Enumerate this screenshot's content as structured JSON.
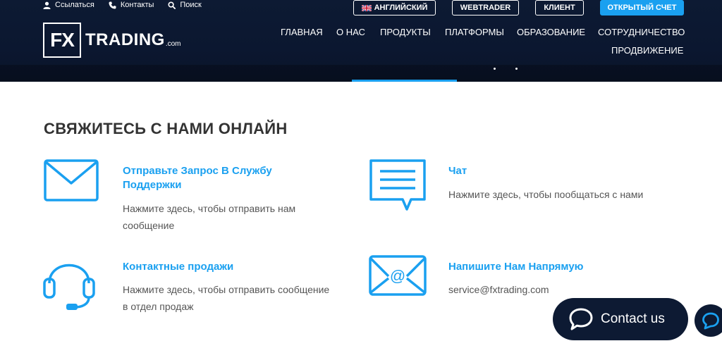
{
  "header": {
    "top_links": [
      "Ссылаться",
      "Контакты",
      "Поиск"
    ],
    "buttons": {
      "language": "АНГЛИЙСКИЙ",
      "webtrader": "WEBTRADER",
      "client": "КЛИЕНТ",
      "open_account": "ОТКРЫТЫЙ СЧЕТ"
    },
    "logo": {
      "mark": "FX",
      "word": "TRADING",
      "suffix": ".com"
    },
    "nav": [
      "ГЛАВНАЯ",
      "О НАС",
      "ПРОДУКТЫ",
      "ПЛАТФОРМЫ",
      "ОБРАЗОВАНИЕ",
      "СОТРУДНИЧЕСТВО",
      "ПРОДВИЖЕНИЕ"
    ]
  },
  "main": {
    "title": "СВЯЖИТЕСЬ С НАМИ ОНЛАЙН",
    "cards": [
      {
        "title_line1": "Отправьте Запрос В Службу",
        "title_line2": "Поддержки",
        "desc_line1": "Нажмите здесь, чтобы отправить нам",
        "desc_line2": "сообщение"
      },
      {
        "title_line1": "Чат",
        "desc_line1": "Нажмите здесь, чтобы пообщаться с нами"
      },
      {
        "title_line1": "Контактные продажи",
        "desc_line1": "Нажмите здесь, чтобы отправить сообщение",
        "desc_line2": "в отдел продаж"
      },
      {
        "title_line1": "Напишите Нам Напрямую",
        "desc_line1": "service@fxtrading.com"
      }
    ]
  },
  "widget": {
    "contact_label": "Contact us"
  },
  "colors": {
    "accent": "#1aa0f0",
    "header_bg": "#0d1a33",
    "title": "#333333",
    "text": "#555555"
  }
}
